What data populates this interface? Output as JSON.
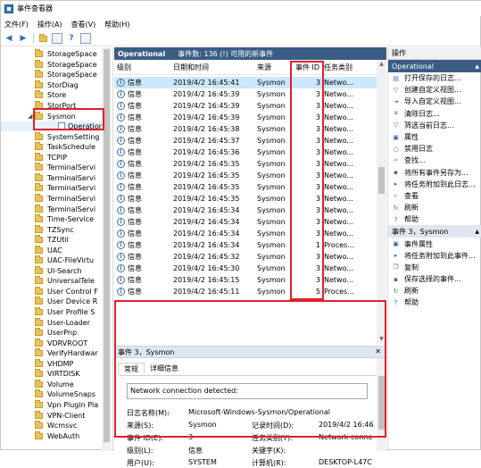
{
  "window": {
    "title": "事件查看器"
  },
  "menu": [
    "文件(F)",
    "操作(A)",
    "查看(V)",
    "帮助(H)"
  ],
  "toolbar": {
    "back": "back-icon",
    "forward": "forward-icon"
  },
  "tree": {
    "items": [
      {
        "label": "StorageSpace",
        "type": "folder"
      },
      {
        "label": "StorageSpace",
        "type": "folder"
      },
      {
        "label": "StorageSpace",
        "type": "folder"
      },
      {
        "label": "StorDiag",
        "type": "folder"
      },
      {
        "label": "Store",
        "type": "folder"
      },
      {
        "label": "StorPort",
        "type": "folder"
      },
      {
        "label": "Sysmon",
        "type": "folder",
        "expanded": true
      },
      {
        "label": "Operation",
        "type": "log",
        "selected": true
      },
      {
        "label": "SystemSetting",
        "type": "folder"
      },
      {
        "label": "TaskSchedule",
        "type": "folder"
      },
      {
        "label": "TCPIP",
        "type": "folder"
      },
      {
        "label": "TerminalServi",
        "type": "folder"
      },
      {
        "label": "TerminalServi",
        "type": "folder"
      },
      {
        "label": "TerminalServi",
        "type": "folder"
      },
      {
        "label": "TerminalServi",
        "type": "folder"
      },
      {
        "label": "TerminalServi",
        "type": "folder"
      },
      {
        "label": "Time-Service",
        "type": "folder"
      },
      {
        "label": "TZSync",
        "type": "folder"
      },
      {
        "label": "TZUtil",
        "type": "folder"
      },
      {
        "label": "UAC",
        "type": "folder"
      },
      {
        "label": "UAC-FileVirtu",
        "type": "folder"
      },
      {
        "label": "UI-Search",
        "type": "folder"
      },
      {
        "label": "UniversalTele",
        "type": "folder"
      },
      {
        "label": "User Control F",
        "type": "folder"
      },
      {
        "label": "User Device R",
        "type": "folder"
      },
      {
        "label": "User Profile S",
        "type": "folder"
      },
      {
        "label": "User-Loader",
        "type": "folder"
      },
      {
        "label": "UserPnp",
        "type": "folder"
      },
      {
        "label": "VDRVROOT",
        "type": "folder"
      },
      {
        "label": "VerifyHardwar",
        "type": "folder"
      },
      {
        "label": "VHDMP",
        "type": "folder"
      },
      {
        "label": "VIRTDISK",
        "type": "folder"
      },
      {
        "label": "Volume",
        "type": "folder"
      },
      {
        "label": "VolumeSnaps",
        "type": "folder"
      },
      {
        "label": "Vpn Plugin Pla",
        "type": "folder"
      },
      {
        "label": "VPN-Client",
        "type": "folder"
      },
      {
        "label": "Wcmsvc",
        "type": "folder"
      },
      {
        "label": "WebAuth",
        "type": "folder"
      }
    ]
  },
  "events_pane": {
    "name": "Operational",
    "summary": "事件数: 136 (!) 可用的新事件",
    "columns": [
      "级别",
      "日期和时间",
      "来源",
      "事件 ID",
      "任务类别"
    ],
    "rows": [
      [
        "信息",
        "2019/4/2 16:45:41",
        "Sysmon",
        "3",
        "Netwo..."
      ],
      [
        "信息",
        "2019/4/2 16:45:39",
        "Sysmon",
        "3",
        "Netwo..."
      ],
      [
        "信息",
        "2019/4/2 16:45:39",
        "Sysmon",
        "3",
        "Netwo..."
      ],
      [
        "信息",
        "2019/4/2 16:45:39",
        "Sysmon",
        "3",
        "Netwo..."
      ],
      [
        "信息",
        "2019/4/2 16:45:38",
        "Sysmon",
        "3",
        "Netwo..."
      ],
      [
        "信息",
        "2019/4/2 16:45:37",
        "Sysmon",
        "3",
        "Netwo..."
      ],
      [
        "信息",
        "2019/4/2 16:45:36",
        "Sysmon",
        "3",
        "Netwo..."
      ],
      [
        "信息",
        "2019/4/2 16:45:35",
        "Sysmon",
        "3",
        "Netwo..."
      ],
      [
        "信息",
        "2019/4/2 16:45:35",
        "Sysmon",
        "3",
        "Netwo..."
      ],
      [
        "信息",
        "2019/4/2 16:45:35",
        "Sysmon",
        "3",
        "Netwo..."
      ],
      [
        "信息",
        "2019/4/2 16:45:35",
        "Sysmon",
        "3",
        "Netwo..."
      ],
      [
        "信息",
        "2019/4/2 16:45:34",
        "Sysmon",
        "3",
        "Netwo..."
      ],
      [
        "信息",
        "2019/4/2 16:45:34",
        "Sysmon",
        "3",
        "Netwo..."
      ],
      [
        "信息",
        "2019/4/2 16:45:34",
        "Sysmon",
        "3",
        "Netwo..."
      ],
      [
        "信息",
        "2019/4/2 16:45:34",
        "Sysmon",
        "1",
        "Proces..."
      ],
      [
        "信息",
        "2019/4/2 16:45:32",
        "Sysmon",
        "3",
        "Netwo..."
      ],
      [
        "信息",
        "2019/4/2 16:45:30",
        "Sysmon",
        "3",
        "Netwo..."
      ],
      [
        "信息",
        "2019/4/2 16:45:15",
        "Sysmon",
        "3",
        "Netwo..."
      ],
      [
        "信息",
        "2019/4/2 16:45:11",
        "Sysmon",
        "5",
        "Proces..."
      ]
    ]
  },
  "detail": {
    "title": "事件 3，Sysmon",
    "tabs": [
      "常规",
      "详细信息"
    ],
    "message": "Network connection detected:",
    "fields": {
      "log_name_label": "日志名称(M):",
      "log_name_value": "Microsoft-Windows-Sysmon/Operational",
      "source_label": "来源(S):",
      "source_value": "Sysmon",
      "logged_label": "记录时间(D):",
      "logged_value": "2019/4/2 16:46",
      "event_id_label": "事件 ID(E):",
      "event_id_value": "3",
      "task_label": "任务类别(Y):",
      "task_value": "Network conne",
      "level_label": "级别(L):",
      "level_value": "信息",
      "keywords_label": "关键字(K):",
      "user_label": "用户(U):",
      "user_value": "SYSTEM",
      "computer_label": "计算机(R):",
      "computer_value": "DESKTOP-L47C"
    }
  },
  "actions": {
    "header": "操作",
    "section1": "Operational",
    "items1": [
      {
        "label": "打开保存的日志...",
        "icon": "folder-open-icon"
      },
      {
        "label": "创建自定义视图...",
        "icon": "filter-icon"
      },
      {
        "label": "导入自定义视图...",
        "icon": "import-icon"
      },
      {
        "label": "清除日志...",
        "icon": "clear-icon"
      },
      {
        "label": "筛选当前日志...",
        "icon": "filter-icon"
      },
      {
        "label": "属性",
        "icon": "properties-icon"
      },
      {
        "label": "禁用日志",
        "icon": "disable-icon"
      },
      {
        "label": "查找...",
        "icon": "find-icon"
      },
      {
        "label": "将所有事件另存为...",
        "icon": "save-icon"
      },
      {
        "label": "将任务附加到此日志...",
        "icon": "task-icon"
      },
      {
        "label": "查看",
        "icon": "view-icon"
      },
      {
        "label": "刷新",
        "icon": "refresh-icon"
      },
      {
        "label": "帮助",
        "icon": "help-icon"
      }
    ],
    "section2": "事件 3，Sysmon",
    "items2": [
      {
        "label": "事件属性",
        "icon": "properties-icon"
      },
      {
        "label": "将任务附加到此事件...",
        "icon": "task-icon"
      },
      {
        "label": "复制",
        "icon": "copy-icon"
      },
      {
        "label": "保存选择的事件...",
        "icon": "save-icon"
      },
      {
        "label": "刷新",
        "icon": "refresh-icon"
      },
      {
        "label": "帮助",
        "icon": "help-icon"
      }
    ]
  },
  "colors": {
    "pane_header": "#3a5d86",
    "highlight": "#e0202a",
    "selection": "#cce8ff"
  }
}
